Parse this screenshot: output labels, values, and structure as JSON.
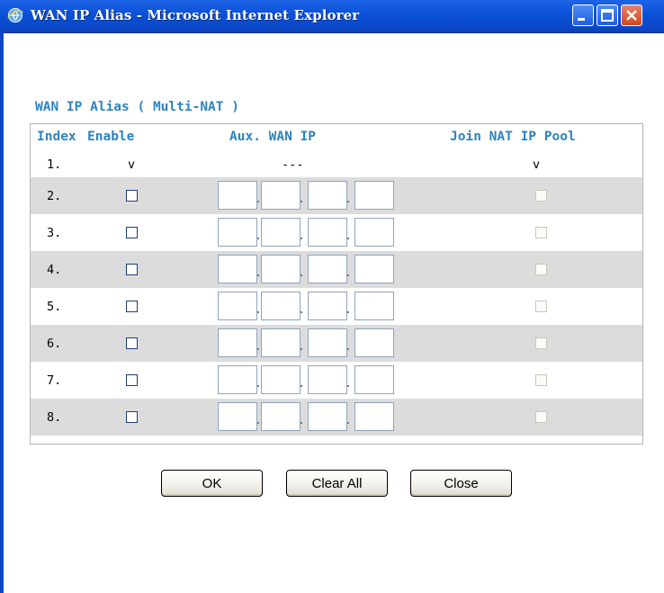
{
  "window": {
    "title": "WAN IP Alias - Microsoft Internet Explorer"
  },
  "form": {
    "heading": "WAN IP Alias ( Multi-NAT )",
    "columns": {
      "index": "Index",
      "enable": "Enable",
      "aux_wan_ip": "Aux. WAN IP",
      "join_nat_ip_pool": "Join NAT IP Pool"
    },
    "first_row": {
      "index": "1.",
      "enable": "v",
      "aux_wan_ip": "---",
      "join_nat_ip_pool": "v"
    },
    "rows": [
      {
        "index": "2."
      },
      {
        "index": "3."
      },
      {
        "index": "4."
      },
      {
        "index": "5."
      },
      {
        "index": "6."
      },
      {
        "index": "7."
      },
      {
        "index": "8."
      }
    ]
  },
  "buttons": {
    "ok": "OK",
    "clear_all": "Clear All",
    "close": "Close"
  },
  "colors": {
    "titlebar": "#0b52d8",
    "label_blue": "#2c84c0",
    "row_shade": "#dcdcdc"
  }
}
